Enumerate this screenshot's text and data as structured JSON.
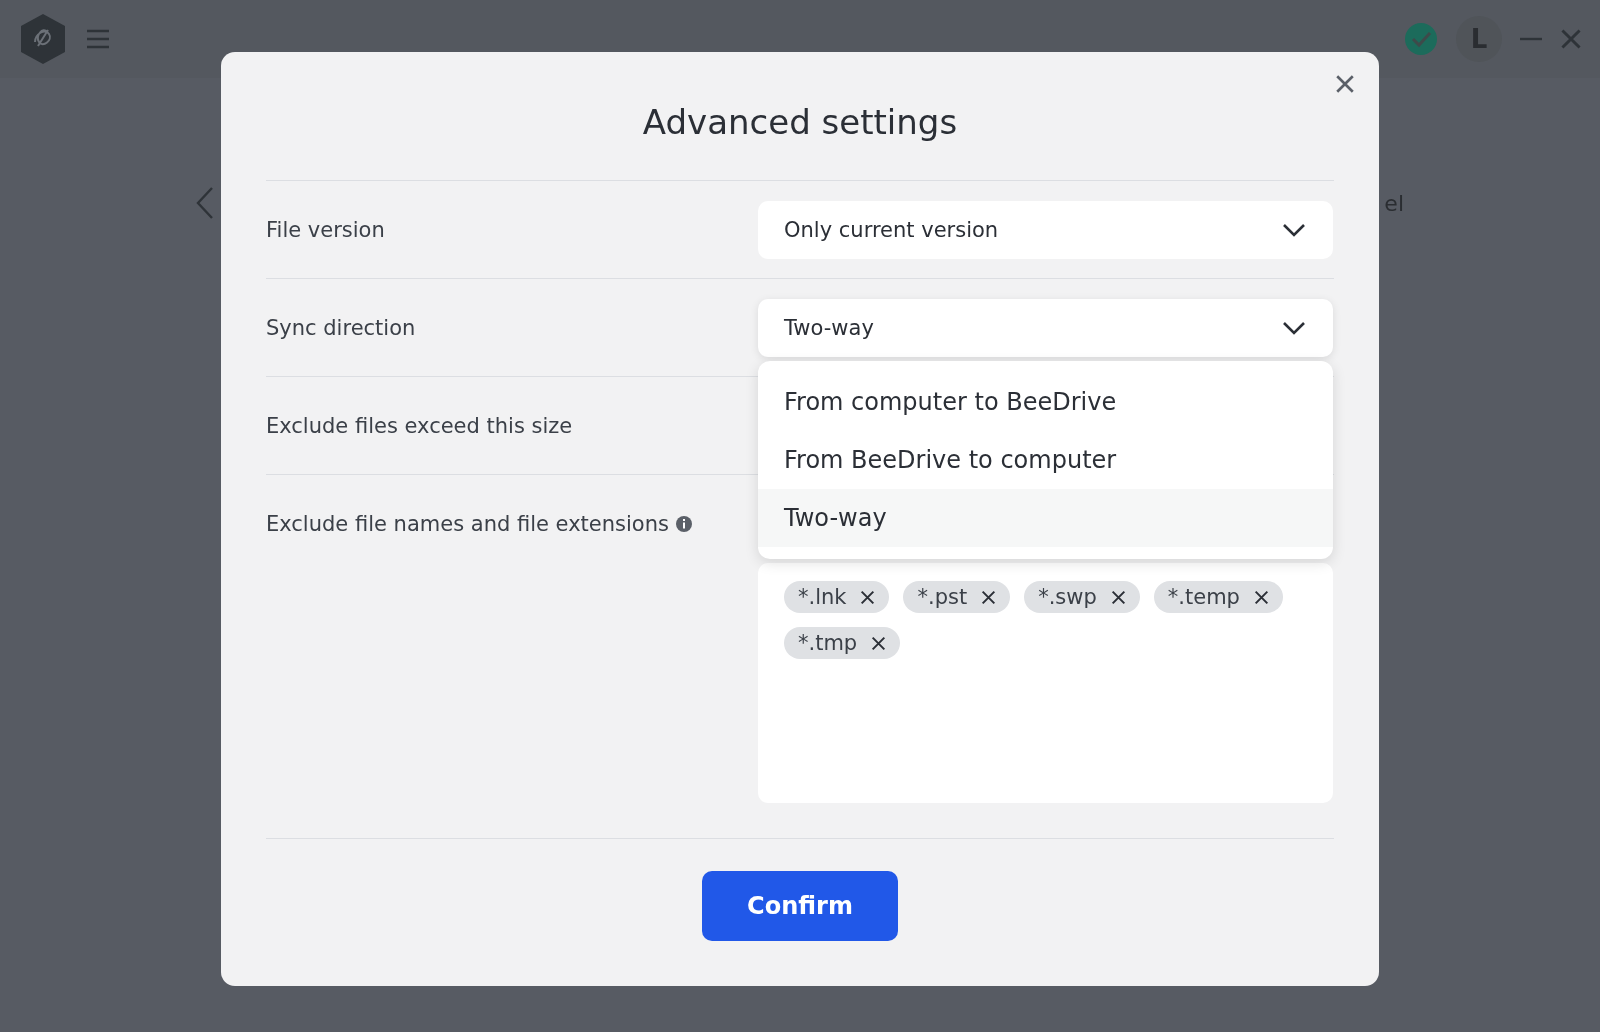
{
  "app_bar": {
    "avatar_initial": "L"
  },
  "background": {
    "partial_text": "el"
  },
  "dialog": {
    "title": "Advanced settings",
    "rows": [
      {
        "kind": "select",
        "label": "File version",
        "value": "Only current version",
        "expanded": false
      },
      {
        "kind": "select",
        "label": "Sync direction",
        "value": "Two-way",
        "expanded": true,
        "options": [
          {
            "label": "From computer to BeeDrive",
            "selected": false
          },
          {
            "label": "From BeeDrive to computer",
            "selected": false
          },
          {
            "label": "Two-way",
            "selected": true
          }
        ]
      },
      {
        "kind": "size",
        "label": "Exclude files exceed this size"
      },
      {
        "kind": "tags",
        "label": "Exclude file names and file extensions",
        "tags": [
          "*.lnk",
          "*.pst",
          "*.swp",
          "*.temp",
          "*.tmp"
        ]
      }
    ],
    "confirm_button": "Confirm"
  }
}
